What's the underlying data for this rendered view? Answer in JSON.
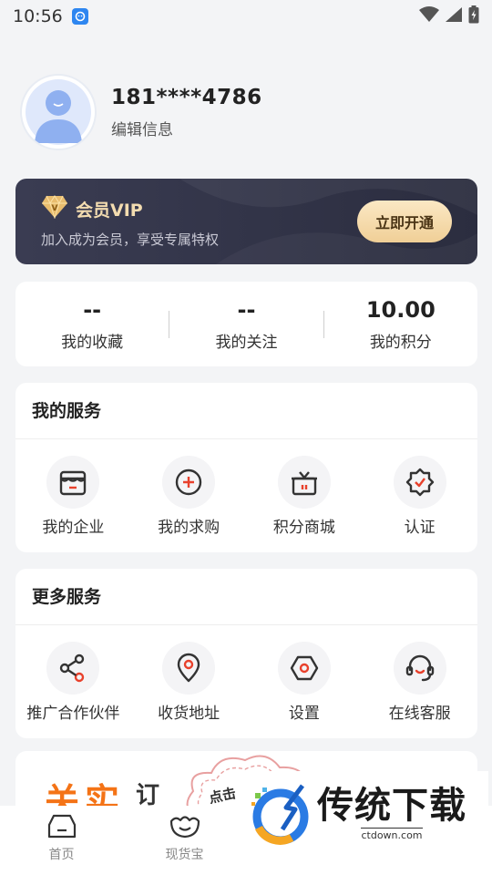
{
  "status_bar": {
    "time": "10:56"
  },
  "profile": {
    "phone": "181****4786",
    "edit_label": "编辑信息"
  },
  "vip": {
    "title": "会员VIP",
    "subtitle": "加入成为会员，享受专属特权",
    "button": "立即开通"
  },
  "stats": [
    {
      "value": "--",
      "label": "我的收藏"
    },
    {
      "value": "--",
      "label": "我的关注"
    },
    {
      "value": "10.00",
      "label": "我的积分"
    }
  ],
  "my_services": {
    "title": "我的服务",
    "items": [
      {
        "label": "我的企业",
        "icon": "store-icon"
      },
      {
        "label": "我的求购",
        "icon": "plus-circle-icon"
      },
      {
        "label": "积分商城",
        "icon": "gift-icon"
      },
      {
        "label": "认证",
        "icon": "verified-badge-icon"
      }
    ]
  },
  "more_services": {
    "title": "更多服务",
    "items": [
      {
        "label": "推广合作伙伴",
        "icon": "share-icon"
      },
      {
        "label": "收货地址",
        "icon": "location-pin-icon"
      },
      {
        "label": "设置",
        "icon": "settings-hexagon-icon"
      },
      {
        "label": "在线客服",
        "icon": "headset-icon"
      }
    ]
  },
  "banner": {
    "text": "关实",
    "sub": "订",
    "cloud_text": "点击"
  },
  "tab_bar": [
    {
      "label": "首页",
      "icon": "home-icon"
    },
    {
      "label": "现货宝",
      "icon": "treasure-icon"
    }
  ],
  "watermark": {
    "title": "传统下载",
    "url": "ctdown.com"
  },
  "colors": {
    "accent": "#e8412c",
    "vip_gold": "#f3dcb0",
    "banner_orange": "#f47316"
  }
}
